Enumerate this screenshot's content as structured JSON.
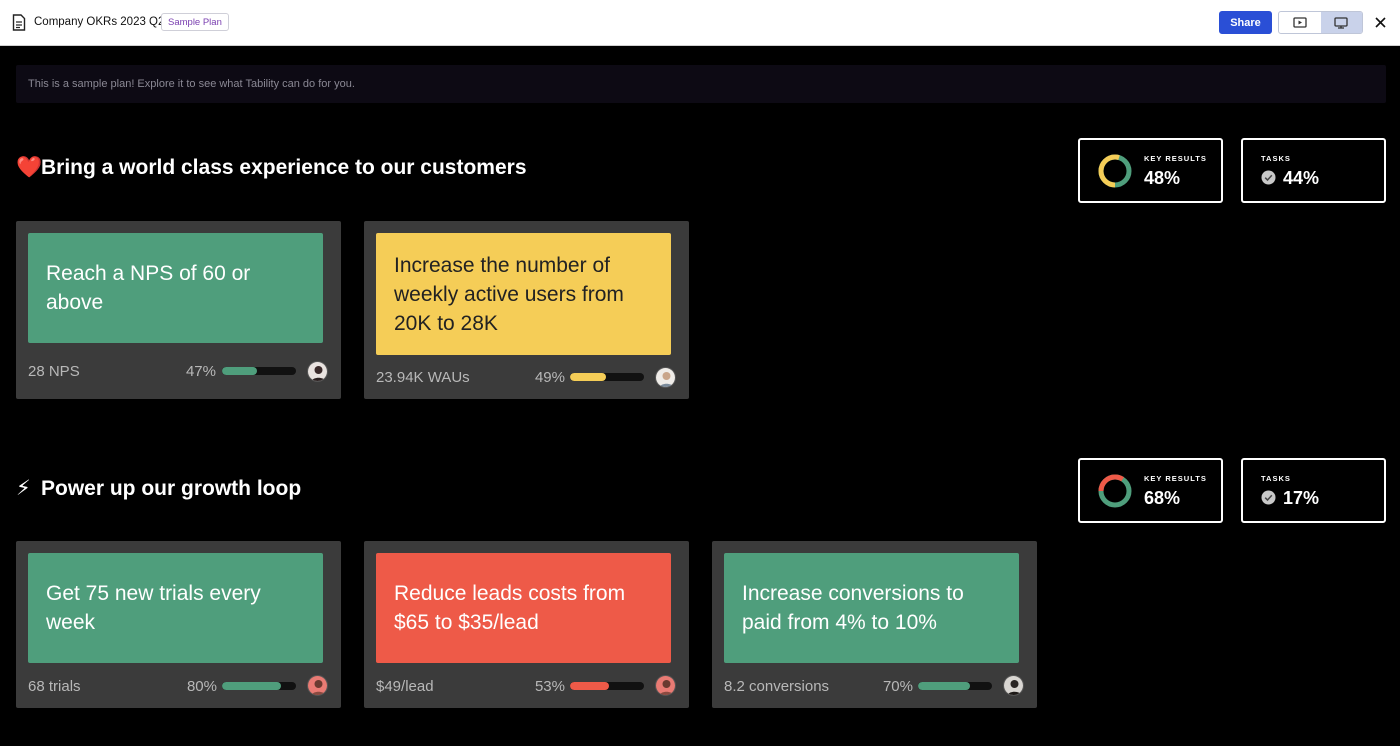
{
  "header": {
    "title": "Company OKRs 2023 Q2",
    "badge": "Sample Plan",
    "share_label": "Share"
  },
  "banner": {
    "text": "This is a sample plan! Explore it to see what Tability can do for you."
  },
  "colors": {
    "green": "#4f9e7c",
    "yellow": "#f5cd57",
    "red": "#ee5a48",
    "share_blue": "#2a4fd6"
  },
  "objectives": [
    {
      "emoji": "❤️",
      "title": "Bring a world class experience to our customers",
      "key_results_label": "KEY RESULTS",
      "key_results_value": "48%",
      "tasks_label": "TASKS",
      "tasks_value": "44%",
      "cards": [
        {
          "text": "Reach a NPS of 60 or above",
          "metric": "28 NPS",
          "pct": "47%",
          "progress": 0.47,
          "color": "green"
        },
        {
          "text": "Increase the number of weekly active users from 20K to 28K",
          "metric": "23.94K WAUs",
          "pct": "49%",
          "progress": 0.49,
          "color": "yellow"
        }
      ]
    },
    {
      "emoji": "⚡",
      "title": "Power up our growth loop",
      "key_results_label": "KEY RESULTS",
      "key_results_value": "68%",
      "tasks_label": "TASKS",
      "tasks_value": "17%",
      "cards": [
        {
          "text": "Get 75 new trials every week",
          "metric": "68 trials",
          "pct": "80%",
          "progress": 0.8,
          "color": "green"
        },
        {
          "text": "Reduce leads costs from $65 to $35/lead",
          "metric": "$49/lead",
          "pct": "53%",
          "progress": 0.53,
          "color": "red"
        },
        {
          "text": "Increase conversions to paid from 4% to 10%",
          "metric": "8.2 conversions",
          "pct": "70%",
          "progress": 0.7,
          "color": "green"
        }
      ]
    }
  ]
}
